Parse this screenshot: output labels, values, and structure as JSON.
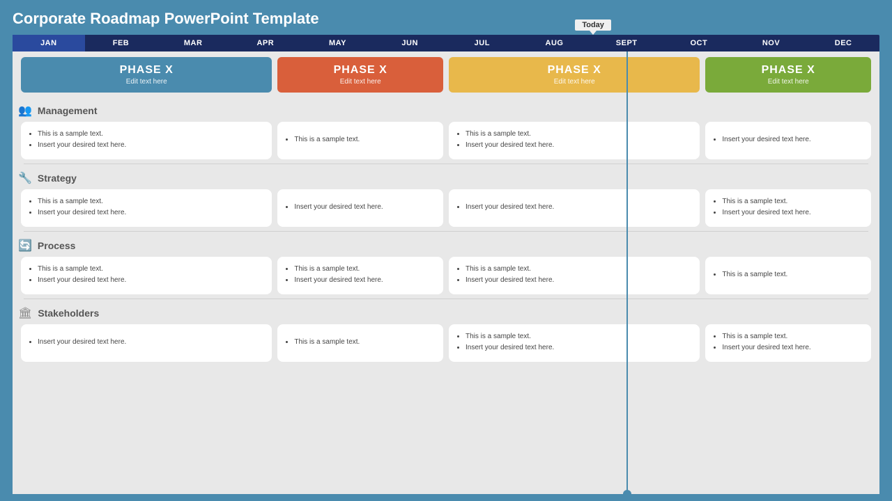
{
  "title": "Corporate Roadmap PowerPoint Template",
  "today_label": "Today",
  "months": [
    "JAN",
    "FEB",
    "MAR",
    "APR",
    "MAY",
    "JUN",
    "JUL",
    "AUG",
    "SEPT",
    "OCT",
    "NOV",
    "DEC"
  ],
  "active_month_index": 0,
  "phases": [
    {
      "label": "PHASE X",
      "subtitle": "Edit text here",
      "color": "blue",
      "span": "cols1-3"
    },
    {
      "label": "PHASE X",
      "subtitle": "Edit text here",
      "color": "orange",
      "span": "col4-5"
    },
    {
      "label": "PHASE X",
      "subtitle": "Edit text here",
      "color": "yellow",
      "span": "cols6-8"
    },
    {
      "label": "PHASE X",
      "subtitle": "Edit text here",
      "color": "green",
      "span": "cols9-12"
    }
  ],
  "sections": [
    {
      "id": "management",
      "icon": "👥",
      "title": "Management",
      "cards": [
        {
          "items": [
            "This is a sample text.",
            "Insert your desired text here."
          ]
        },
        {
          "items": [
            "This is a sample text."
          ]
        },
        {
          "items": [
            "This is a sample text.",
            "Insert your desired text here."
          ]
        },
        {
          "items": [
            "Insert your desired text here."
          ]
        }
      ]
    },
    {
      "id": "strategy",
      "icon": "🔧",
      "title": "Strategy",
      "cards": [
        {
          "items": [
            "This is a sample text.",
            "Insert your desired text here."
          ]
        },
        {
          "items": [
            "Insert your desired text here."
          ]
        },
        {
          "items": [
            "Insert your desired text here."
          ]
        },
        {
          "items": [
            "This is a sample text.",
            "Insert your desired text here."
          ]
        }
      ]
    },
    {
      "id": "process",
      "icon": "🔄",
      "title": "Process",
      "cards": [
        {
          "items": [
            "This is a sample text.",
            "Insert your desired text here."
          ]
        },
        {
          "items": [
            "This is a sample text.",
            "Insert your desired text here."
          ]
        },
        {
          "items": [
            "This is a sample text.",
            "Insert your desired text here."
          ]
        },
        {
          "items": [
            "This is a sample text."
          ]
        }
      ]
    },
    {
      "id": "stakeholders",
      "icon": "🏛",
      "title": "Stakeholders",
      "cards": [
        {
          "items": [
            "Insert your desired text here."
          ]
        },
        {
          "items": [
            "This is a sample text."
          ]
        },
        {
          "items": [
            "This is a sample text.",
            "Insert your desired text here."
          ]
        },
        {
          "items": [
            "This is a sample text.",
            "Insert your desired text here."
          ]
        }
      ]
    }
  ]
}
